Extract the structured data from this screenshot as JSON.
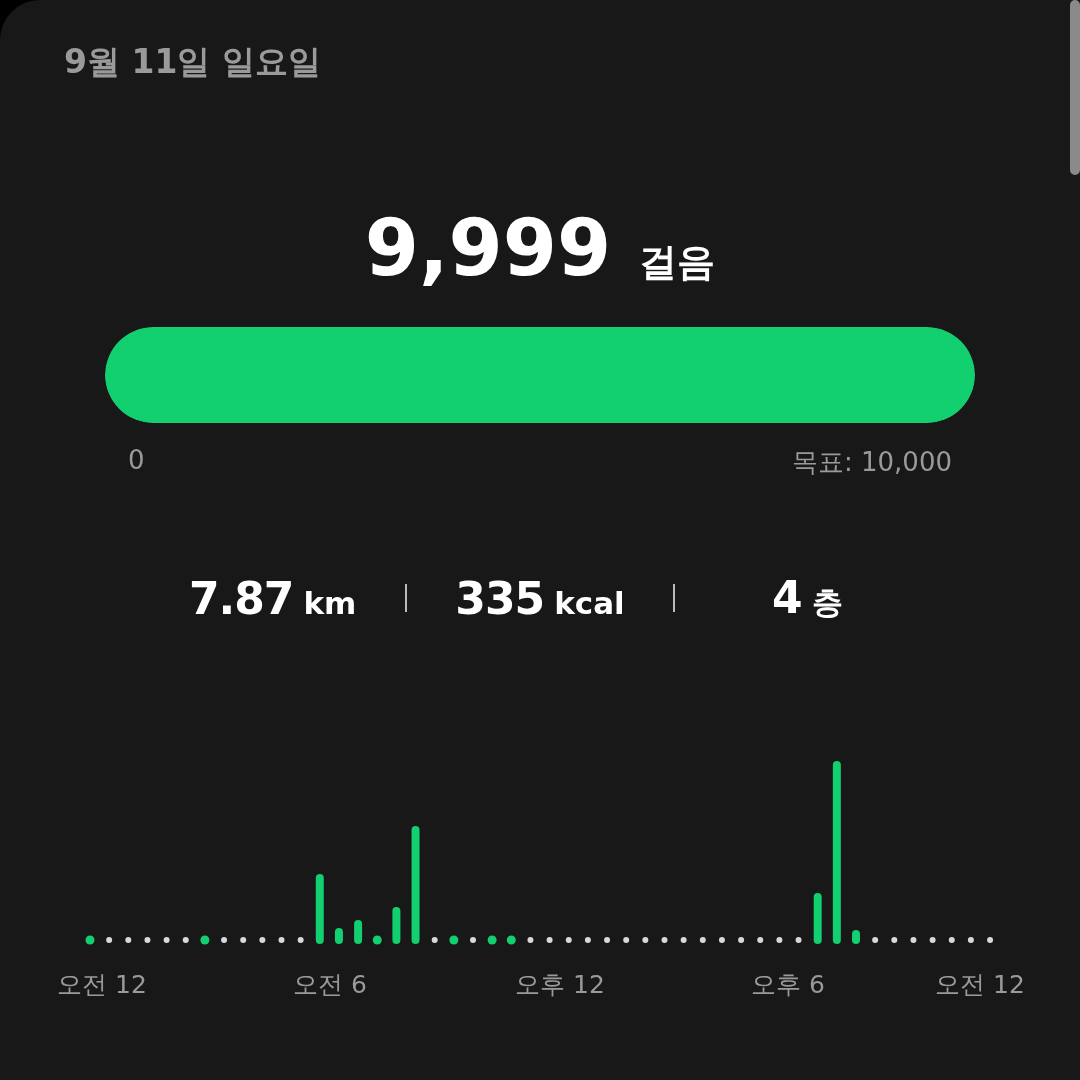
{
  "date": "9월 11일 일요일",
  "steps": {
    "count": "9,999",
    "unit": "걸음"
  },
  "progress": {
    "level": 0.9999,
    "start_label": "0",
    "goal_label": "목표: 10,000"
  },
  "stats": [
    {
      "value": "7.87",
      "unit": "km"
    },
    {
      "value": "335",
      "unit": "kcal"
    },
    {
      "value": "4",
      "unit": "층"
    }
  ],
  "activity_chart": {
    "axis_labels": [
      "오전 12",
      "오전 6",
      "오후 12",
      "오후 6",
      "오전 12"
    ]
  }
}
